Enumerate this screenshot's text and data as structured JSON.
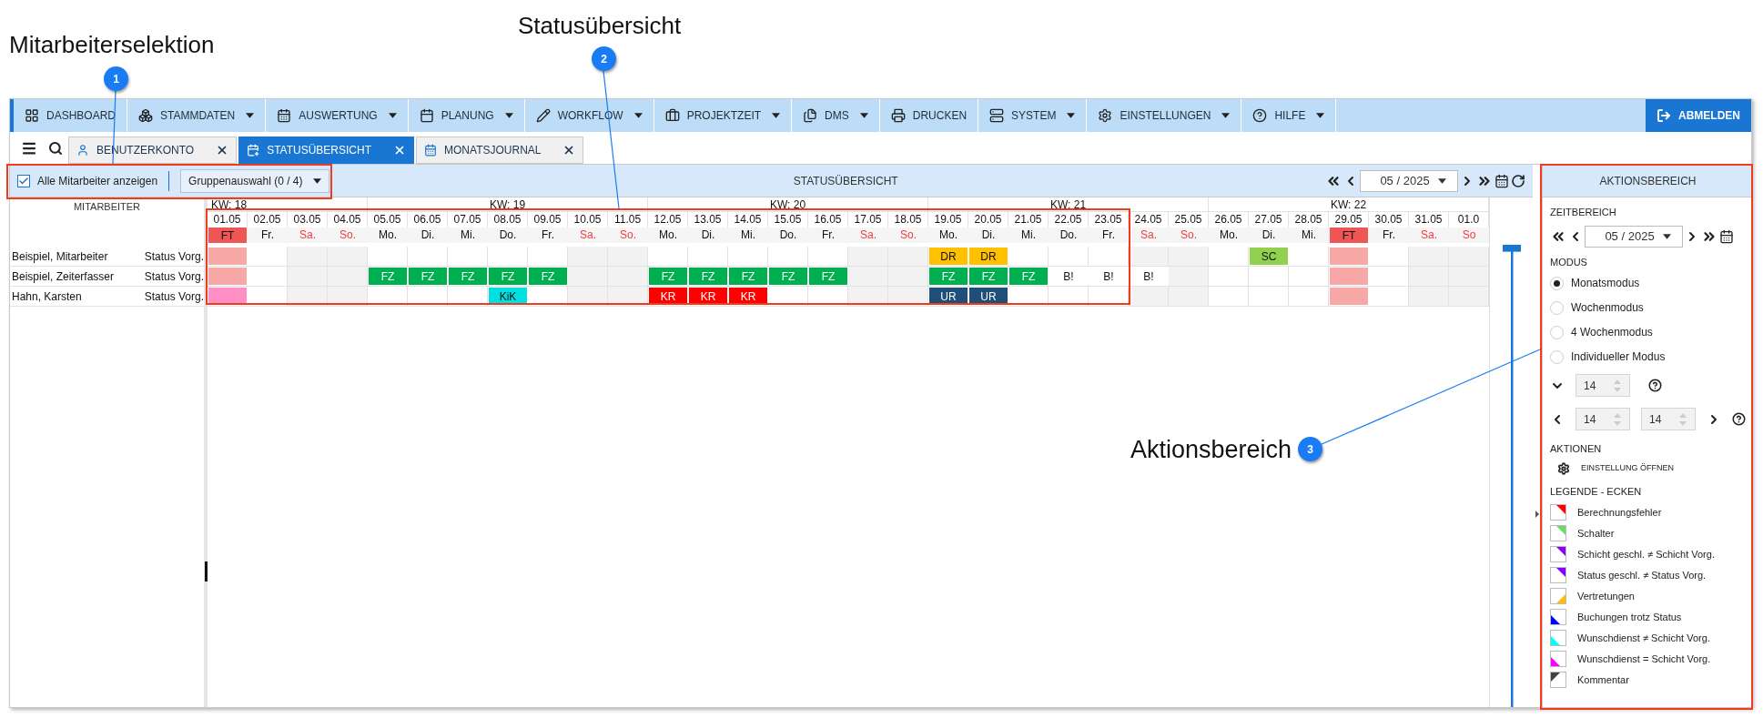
{
  "annotations": [
    {
      "number": "1",
      "label": "Mitarbeiterselektion"
    },
    {
      "number": "2",
      "label": "Statusübersicht"
    },
    {
      "number": "3",
      "label": "Aktionsbereich"
    }
  ],
  "nav": {
    "items": [
      {
        "label": "DASHBOARD",
        "dropdown": false
      },
      {
        "label": "STAMMDATEN",
        "dropdown": true
      },
      {
        "label": "AUSWERTUNG",
        "dropdown": true
      },
      {
        "label": "PLANUNG",
        "dropdown": true
      },
      {
        "label": "WORKFLOW",
        "dropdown": true
      },
      {
        "label": "PROJEKTZEIT",
        "dropdown": true
      },
      {
        "label": "DMS",
        "dropdown": true
      },
      {
        "label": "DRUCKEN",
        "dropdown": false
      },
      {
        "label": "SYSTEM",
        "dropdown": true
      },
      {
        "label": "EINSTELLUNGEN",
        "dropdown": true
      },
      {
        "label": "HILFE",
        "dropdown": true
      }
    ],
    "logout": "ABMELDEN"
  },
  "tabs": [
    {
      "label": "BENUTZERKONTO",
      "selected": false
    },
    {
      "label": "STATUSÜBERSICHT",
      "selected": true
    },
    {
      "label": "MONATSJOURNAL",
      "selected": false
    }
  ],
  "toolbar": {
    "show_all": {
      "label": "Alle Mitarbeiter anzeigen",
      "checked": true
    },
    "group_select": "Gruppenauswahl (0 / 4)",
    "title": "STATUSÜBERSICHT",
    "month": "05 / 2025"
  },
  "weeks": [
    {
      "label": "KW: 18",
      "days": [
        {
          "date": "01.05",
          "weekday": "FT",
          "kind": "holiday"
        },
        {
          "date": "02.05",
          "weekday": "Fr.",
          "kind": "workday"
        },
        {
          "date": "03.05",
          "weekday": "Sa.",
          "kind": "weekend"
        },
        {
          "date": "04.05",
          "weekday": "So.",
          "kind": "weekend"
        }
      ]
    },
    {
      "label": "KW: 19",
      "days": [
        {
          "date": "05.05",
          "weekday": "Mo.",
          "kind": "workday"
        },
        {
          "date": "06.05",
          "weekday": "Di.",
          "kind": "workday"
        },
        {
          "date": "07.05",
          "weekday": "Mi.",
          "kind": "workday"
        },
        {
          "date": "08.05",
          "weekday": "Do.",
          "kind": "workday"
        },
        {
          "date": "09.05",
          "weekday": "Fr.",
          "kind": "workday"
        },
        {
          "date": "10.05",
          "weekday": "Sa.",
          "kind": "weekend"
        },
        {
          "date": "11.05",
          "weekday": "So.",
          "kind": "weekend"
        }
      ]
    },
    {
      "label": "KW: 20",
      "days": [
        {
          "date": "12.05",
          "weekday": "Mo.",
          "kind": "workday"
        },
        {
          "date": "13.05",
          "weekday": "Di.",
          "kind": "workday"
        },
        {
          "date": "14.05",
          "weekday": "Mi.",
          "kind": "workday"
        },
        {
          "date": "15.05",
          "weekday": "Do.",
          "kind": "workday"
        },
        {
          "date": "16.05",
          "weekday": "Fr.",
          "kind": "workday"
        },
        {
          "date": "17.05",
          "weekday": "Sa.",
          "kind": "weekend"
        },
        {
          "date": "18.05",
          "weekday": "So.",
          "kind": "weekend"
        }
      ]
    },
    {
      "label": "KW: 21",
      "days": [
        {
          "date": "19.05",
          "weekday": "Mo.",
          "kind": "workday"
        },
        {
          "date": "20.05",
          "weekday": "Di.",
          "kind": "workday"
        },
        {
          "date": "21.05",
          "weekday": "Mi.",
          "kind": "workday"
        },
        {
          "date": "22.05",
          "weekday": "Do.",
          "kind": "workday"
        },
        {
          "date": "23.05",
          "weekday": "Fr.",
          "kind": "workday"
        },
        {
          "date": "24.05",
          "weekday": "Sa.",
          "kind": "weekend"
        },
        {
          "date": "25.05",
          "weekday": "So.",
          "kind": "weekend"
        }
      ]
    },
    {
      "label": "KW: 22",
      "days": [
        {
          "date": "26.05",
          "weekday": "Mo.",
          "kind": "workday"
        },
        {
          "date": "27.05",
          "weekday": "Di.",
          "kind": "workday"
        },
        {
          "date": "28.05",
          "weekday": "Mi.",
          "kind": "workday"
        },
        {
          "date": "29.05",
          "weekday": "FT",
          "kind": "holiday"
        },
        {
          "date": "30.05",
          "weekday": "Fr.",
          "kind": "workday"
        },
        {
          "date": "31.05",
          "weekday": "Sa.",
          "kind": "weekend"
        },
        {
          "date": "01.0",
          "weekday": "So",
          "kind": "weekend"
        }
      ]
    }
  ],
  "employees": {
    "header": "MITARBEITER",
    "rows": [
      {
        "name": "Beispiel, Mitarbeiter",
        "column_2": "Status Vorg.",
        "cells": [
          {
            "color": "#f9a8a8"
          },
          null,
          null,
          null,
          null,
          null,
          null,
          null,
          null,
          null,
          null,
          null,
          null,
          null,
          null,
          null,
          null,
          null,
          {
            "text": "DR",
            "color": "#ffc000"
          },
          {
            "text": "DR",
            "color": "#ffc000"
          },
          null,
          null,
          null,
          null,
          null,
          null,
          {
            "text": "SC",
            "color": "#92d050"
          },
          null,
          {
            "color": "#f9a8a8"
          },
          null,
          null,
          null
        ]
      },
      {
        "name": "Beispiel, Zeiterfasser",
        "column_2": "Status Vorg.",
        "cells": [
          {
            "color": "#f9a8a8"
          },
          null,
          null,
          null,
          {
            "text": "FZ",
            "color": "#00b050"
          },
          {
            "text": "FZ",
            "color": "#00b050"
          },
          {
            "text": "FZ",
            "color": "#00b050"
          },
          {
            "text": "FZ",
            "color": "#00b050"
          },
          {
            "text": "FZ",
            "color": "#00b050"
          },
          null,
          null,
          {
            "text": "FZ",
            "color": "#00b050"
          },
          {
            "text": "FZ",
            "color": "#00b050"
          },
          {
            "text": "FZ",
            "color": "#00b050"
          },
          {
            "text": "FZ",
            "color": "#00b050"
          },
          {
            "text": "FZ",
            "color": "#00b050"
          },
          null,
          null,
          {
            "text": "FZ",
            "color": "#00b050"
          },
          {
            "text": "FZ",
            "color": "#00b050"
          },
          {
            "text": "FZ",
            "color": "#00b050"
          },
          {
            "text": "B!"
          },
          {
            "text": "B!"
          },
          {
            "text": "B!"
          },
          null,
          null,
          null,
          null,
          {
            "color": "#f9a8a8"
          },
          null,
          null,
          null
        ]
      },
      {
        "name": "Hahn, Karsten",
        "column_2": "Status Vorg.",
        "cells": [
          {
            "color": "#ff8fc4"
          },
          null,
          null,
          null,
          null,
          null,
          null,
          {
            "text": "KiK",
            "color": "#00e0e0"
          },
          null,
          null,
          null,
          {
            "text": "KR",
            "color": "#ff0000"
          },
          {
            "text": "KR",
            "color": "#ff0000"
          },
          {
            "text": "KR",
            "color": "#ff0000"
          },
          null,
          null,
          null,
          null,
          {
            "text": "UR",
            "color": "#1f4e79"
          },
          {
            "text": "UR",
            "color": "#1f4e79"
          },
          null,
          null,
          null,
          null,
          null,
          null,
          null,
          null,
          {
            "color": "#f9a8a8"
          },
          null,
          null,
          null
        ]
      }
    ]
  },
  "action_panel": {
    "title": "AKTIONSBEREICH",
    "time_range": {
      "label": "ZEITBEREICH",
      "month": "05 / 2025"
    },
    "mode": {
      "label": "MODUS",
      "options": [
        {
          "label": "Monatsmodus",
          "selected": true
        },
        {
          "label": "Wochenmodus",
          "selected": false
        },
        {
          "label": "4 Wochenmodus",
          "selected": false
        },
        {
          "label": "Individueller Modus",
          "selected": false
        }
      ]
    },
    "spinners": {
      "single": "14",
      "from": "14",
      "to": "14"
    },
    "actions": {
      "label": "AKTIONEN",
      "button": "EINSTELLUNG ÖFFNEN"
    },
    "legend": {
      "label": "LEGENDE - ECKEN",
      "items": [
        {
          "label": "Berechnungsfehler",
          "color": "#ff0000",
          "kind": "topright"
        },
        {
          "label": "Schalter",
          "color": "#66dd66",
          "kind": "topright"
        },
        {
          "label": "Schicht geschl. ≠ Schicht Vorg.",
          "color": "#8800ff",
          "kind": "topright"
        },
        {
          "label": "Status geschl. ≠ Status Vorg.",
          "color": "#8800ff",
          "kind": "topright"
        },
        {
          "label": "Vertretungen",
          "color": "#ffc000",
          "kind": "bottomright"
        },
        {
          "label": "Buchungen trotz Status",
          "color": "#0000ff",
          "kind": "bottomleft"
        },
        {
          "label": "Wunschdienst ≠ Schicht Vorg.",
          "color": "#00ffff",
          "kind": "bottomleft"
        },
        {
          "label": "Wunschdienst = Schicht Vorg.",
          "color": "#ff00ff",
          "kind": "bottomleft"
        },
        {
          "label": "Kommentar",
          "color": "#404040",
          "kind": "topleft"
        }
      ]
    }
  }
}
